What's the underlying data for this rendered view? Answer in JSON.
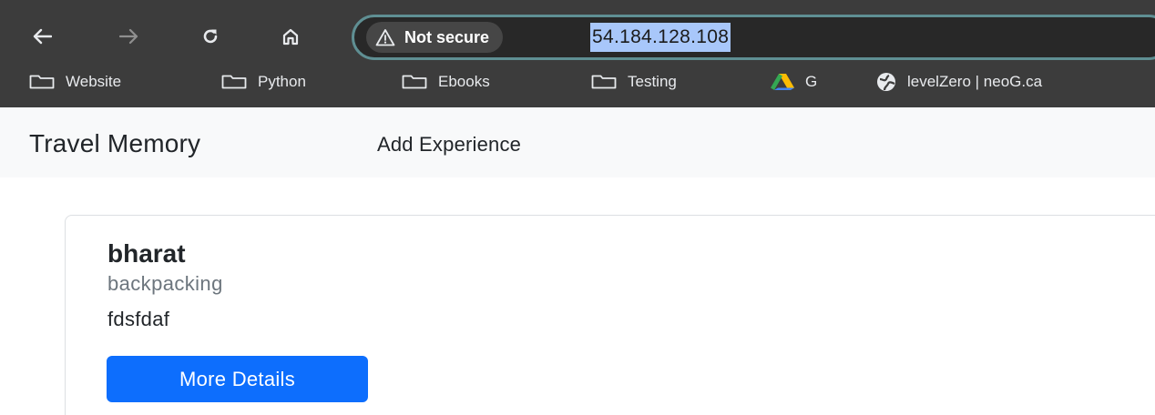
{
  "browser": {
    "nav": {
      "back_icon": "arrow-left-icon",
      "forward_icon": "arrow-right-icon",
      "reload_icon": "reload-icon",
      "home_icon": "home-icon"
    },
    "security_chip": {
      "icon": "warning-triangle-icon",
      "label": "Not secure"
    },
    "url": "54.184.128.108",
    "colors": {
      "chrome_bg": "#3c3c3c",
      "omnibox_bg": "#282828",
      "omnibox_border": "#5f8f93",
      "url_highlight": "#a8c7fa"
    },
    "bookmarks": [
      {
        "label": "Website",
        "icon": "folder-icon"
      },
      {
        "label": "Python",
        "icon": "folder-icon"
      },
      {
        "label": "Ebooks",
        "icon": "folder-icon"
      },
      {
        "label": "Testing",
        "icon": "folder-icon"
      },
      {
        "label": "G",
        "icon": "google-drive-icon"
      },
      {
        "label": "levelZero | neoG.ca",
        "icon": "globe-icon"
      }
    ]
  },
  "navbar": {
    "brand": "Travel Memory",
    "links": [
      {
        "label": "Add Experience"
      }
    ],
    "bg_color": "#f8f9fa"
  },
  "card": {
    "title": "bharat",
    "subtitle": "backpacking",
    "text": "fdsfdaf",
    "button_label": "More Details",
    "button_color": "#0d6efd"
  }
}
